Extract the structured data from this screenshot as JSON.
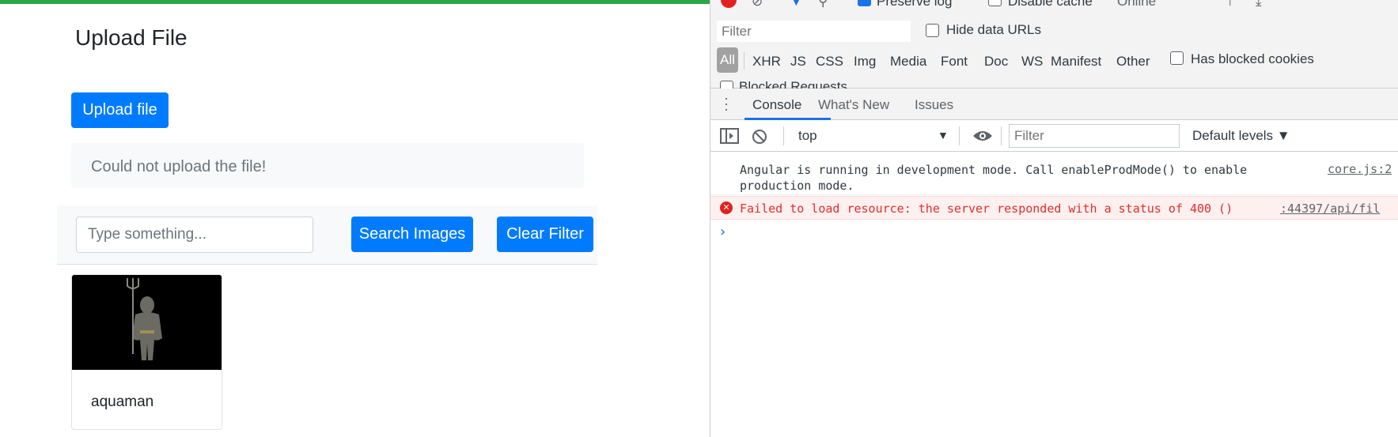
{
  "page": {
    "title": "Upload File",
    "upload_button": "Upload file",
    "alert_message": "Could not upload the file!",
    "search": {
      "placeholder": "Type something...",
      "search_button": "Search Images",
      "clear_button": "Clear Filter"
    },
    "cards": [
      {
        "title": "aquaman"
      }
    ],
    "colors": {
      "primary": "#007bff",
      "top_bar": "#28a745"
    }
  },
  "devtools": {
    "network_toolbar": {
      "preserve_log": "Preserve log",
      "disable_cache": "Disable cache",
      "throttle": "Online"
    },
    "network_filter": {
      "placeholder": "Filter",
      "hide_data_urls": "Hide data URLs",
      "types": [
        "All",
        "XHR",
        "JS",
        "CSS",
        "Img",
        "Media",
        "Font",
        "Doc",
        "WS",
        "Manifest",
        "Other"
      ],
      "has_blocked_cookies": "Has blocked cookies",
      "blocked_requests": "Blocked Requests"
    },
    "drawer_tabs": [
      "Console",
      "What's New",
      "Issues"
    ],
    "console_toolbar": {
      "context": "top",
      "filter_placeholder": "Filter",
      "levels": "Default levels ▼"
    },
    "logs": {
      "info": {
        "text": "Angular is running in development mode. Call enableProdMode() to enable production mode.",
        "source": "core.js:2"
      },
      "error": {
        "text": "Failed to load resource: the server responded with a status of 400 ()",
        "source": ":44397/api/fil"
      }
    },
    "colors": {
      "error_text": "#e12d2d",
      "error_bg": "#fff0f0",
      "accent": "#1a73e8"
    }
  }
}
